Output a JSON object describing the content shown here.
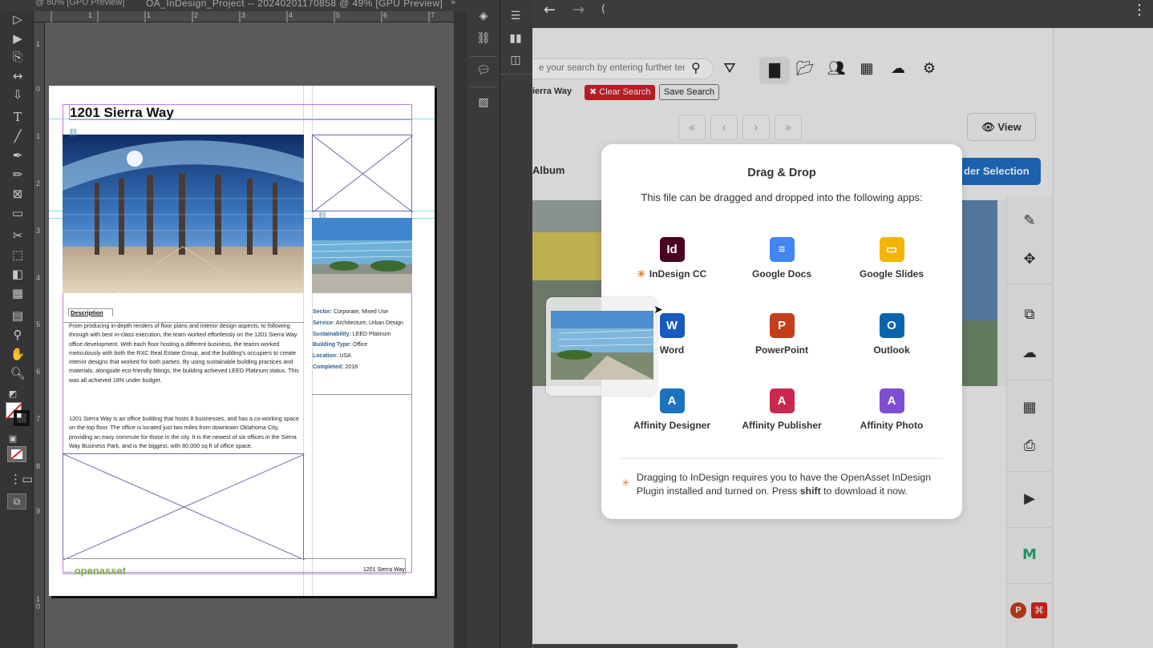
{
  "indesign": {
    "tab_left": "@ 80% [GPU Preview]",
    "tab_main": "OA_InDesign_Project -- 20240201170858 @ 49% [GPU Preview]",
    "ruler_top": [
      "1",
      "1",
      "2",
      "3",
      "4",
      "5",
      "6",
      "7"
    ],
    "ruler_left": [
      "1",
      "0",
      "1",
      "2",
      "3",
      "4",
      "5",
      "6",
      "7",
      "8",
      "9",
      "1\n0",
      "1\n1"
    ],
    "document": {
      "title": "1201 Sierra Way",
      "description_label": "Description",
      "body_p1": "From producing in-depth renders of floor plans and interior design aspects, to following through with best in-class execution, the team worked effortlessly on the 1201 Sierra Way office development. With each floor hosting a different business, the teams worked meticulously with both the RXC Real Estate Group, and the building's occupiers to create interior designs that worked for both parties. By using sustainable building practices and materials, alongside eco-friendly fittings, the building achieved LEED Platinum status. This was all achieved 18% under budget.",
      "body_p2": "1201 Sierra Way is an office building that hosts 8 businesses, and has a co-working space on the top floor. The office is located just two miles from downtown Oklahoma City, providing an easy commute for those in the city. It is the newest of six offices in the Sierra Way Business Park, and is the biggest, with 80,000 sq ft of office space.",
      "meta": [
        {
          "key": "Sector:",
          "value": "Corporate, Mixed Use"
        },
        {
          "key": "Service:",
          "value": "Architecture, Urban Design"
        },
        {
          "key": "Sustainability:",
          "value": "LEED Platinum"
        },
        {
          "key": "Building Type:",
          "value": "Office"
        },
        {
          "key": "Location:",
          "value": "USA"
        },
        {
          "key": "Completed:",
          "value": "2018"
        }
      ],
      "footer_logo": "openasset",
      "footer_text": "1201 Sierra Way"
    }
  },
  "browser": {
    "back": "←",
    "forward": "→",
    "url": "(",
    "menu": "⋮"
  },
  "openasset": {
    "search_placeholder": "e your search by entering further ten",
    "filter_tag": "ierra Way",
    "clear_search": "Clear Search",
    "save_search": "Save Search",
    "view_label": "View",
    "album_label": "Album",
    "order_selection": "der Selection",
    "nav": [
      "«",
      "‹",
      "›",
      "»"
    ]
  },
  "modal": {
    "title": "Drag & Drop",
    "subtitle": "This file can be dragged and dropped into the following apps:",
    "apps": [
      {
        "label": "InDesign CC",
        "icon": "Id",
        "color": "#49021f",
        "starred": true
      },
      {
        "label": "Google Docs",
        "icon": "≡",
        "color": "#4285f4"
      },
      {
        "label": "Google Slides",
        "icon": "▭",
        "color": "#f4b400"
      },
      {
        "label": "Word",
        "icon": "W",
        "color": "#185abd"
      },
      {
        "label": "PowerPoint",
        "icon": "P",
        "color": "#c43e1c"
      },
      {
        "label": "Outlook",
        "icon": "O",
        "color": "#0a64ad"
      },
      {
        "label": "Affinity Designer",
        "icon": "A",
        "color": "#1b72be"
      },
      {
        "label": "Affinity Publisher",
        "icon": "A",
        "color": "#c9284e"
      },
      {
        "label": "Affinity Photo",
        "icon": "A",
        "color": "#7e4dd2"
      }
    ],
    "note_prefix": "Dragging to InDesign requires you to have the OpenAsset InDesign Plugin installed and turned on. Press ",
    "note_key": "shift",
    "note_suffix": " to download it now.",
    "asterisk": "✳"
  },
  "colors": {
    "accent_blue": "#1f6fc5",
    "clear_red": "#d0202a",
    "guide_cyan": "#7fe0e8",
    "frame_magenta": "#c876e6"
  }
}
